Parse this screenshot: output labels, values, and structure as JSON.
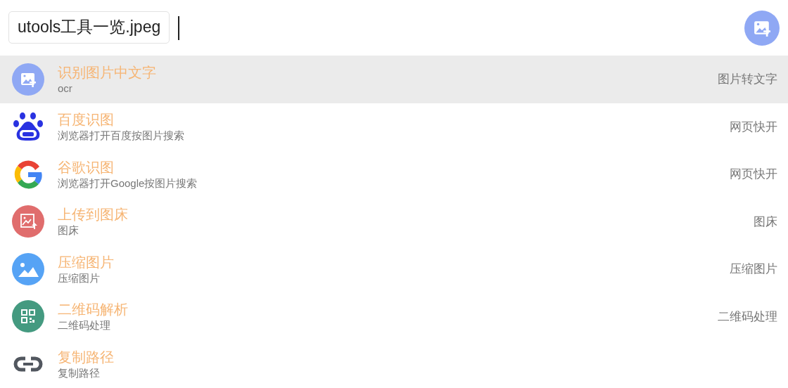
{
  "search": {
    "value": "utools工具一览.jpeg"
  },
  "results": [
    {
      "kind": "image-text",
      "title": "识别图片中文字",
      "subtitle": "ocr",
      "category": "图片转文字",
      "selected": true
    },
    {
      "kind": "paw",
      "title": "百度识图",
      "subtitle": "浏览器打开百度按图片搜索",
      "category": "网页快开",
      "selected": false
    },
    {
      "kind": "g-logo",
      "title": "谷歌识图",
      "subtitle": "浏览器打开Google按图片搜索",
      "category": "网页快开",
      "selected": false
    },
    {
      "kind": "upload",
      "title": "上传到图床",
      "subtitle": "图床",
      "category": "图床",
      "selected": false
    },
    {
      "kind": "landscape",
      "title": "压缩图片",
      "subtitle": "压缩图片",
      "category": "压缩图片",
      "selected": false
    },
    {
      "kind": "qr",
      "title": "二维码解析",
      "subtitle": "二维码处理",
      "category": "二维码处理",
      "selected": false
    },
    {
      "kind": "link",
      "title": "复制路径",
      "subtitle": "复制路径",
      "selected": false
    }
  ]
}
